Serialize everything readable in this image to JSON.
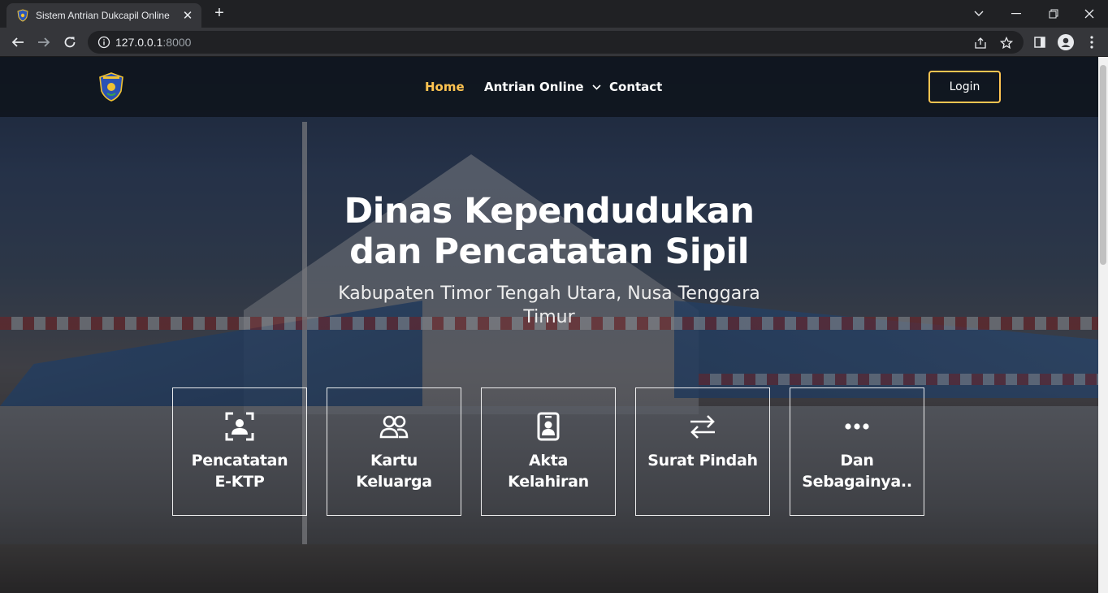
{
  "browser": {
    "tab_title": "Sistem Antrian Dukcapil Online",
    "url_host": "127.0.0.1",
    "url_port": ":8000"
  },
  "header": {
    "nav": [
      {
        "label": "Home",
        "active": true
      },
      {
        "label": "Antrian Online",
        "active": false,
        "has_dropdown": true
      },
      {
        "label": "Contact",
        "active": false
      }
    ],
    "login_label": "Login"
  },
  "hero": {
    "title_line1": "Dinas Kependudukan",
    "title_line2": "dan Pencatatan Sipil",
    "subtitle_line1": "Kabupaten Timor Tengah Utara, Nusa Tenggara",
    "subtitle_line2": "Timur"
  },
  "services": [
    {
      "line1": "Pencatatan",
      "line2": "E-KTP",
      "icon": "id-scan-icon"
    },
    {
      "line1": "Kartu",
      "line2": "Keluarga",
      "icon": "people-icon"
    },
    {
      "line1": "Akta",
      "line2": "Kelahiran",
      "icon": "id-badge-icon"
    },
    {
      "line1": "Surat Pindah",
      "line2": "",
      "icon": "transfer-arrows-icon"
    },
    {
      "line1": "Dan",
      "line2": "Sebagainya..",
      "icon": "more-dots-icon"
    }
  ],
  "colors": {
    "accent": "#ffc451",
    "chrome_dark": "#202124",
    "chrome_toolbar": "#35363a"
  }
}
